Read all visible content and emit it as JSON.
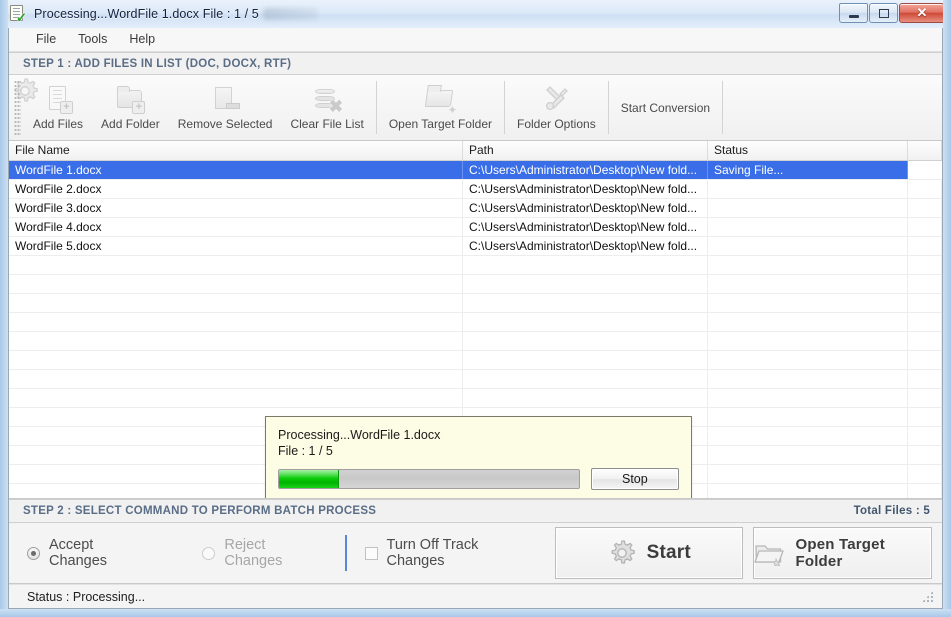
{
  "window": {
    "title": "Processing...WordFile 1.docx File : 1 / 5",
    "icon": "document-check-icon",
    "minimize_label": "–",
    "maximize_label": "□",
    "close_label": "✕"
  },
  "menu": {
    "items": [
      {
        "label": "File"
      },
      {
        "label": "Tools"
      },
      {
        "label": "Help"
      }
    ]
  },
  "step1": {
    "header": "STEP 1 : ADD FILES IN LIST (DOC, DOCX, RTF)"
  },
  "toolbar": {
    "buttons": [
      {
        "label": "Add Files",
        "icon": "add-files-icon"
      },
      {
        "label": "Add Folder",
        "icon": "add-folder-icon"
      },
      {
        "label": "Remove Selected",
        "icon": "remove-selected-icon"
      },
      {
        "label": "Clear File List",
        "icon": "clear-file-list-icon"
      },
      {
        "label": "Open Target Folder",
        "icon": "open-folder-icon"
      },
      {
        "label": "Folder Options",
        "icon": "tools-icon"
      },
      {
        "label": "Start Conversion",
        "icon": "gear-icon"
      }
    ]
  },
  "file_list": {
    "columns": [
      "File Name",
      "Path",
      "Status"
    ],
    "rows": [
      {
        "name": "WordFile 1.docx",
        "path": "C:\\Users\\Administrator\\Desktop\\New fold...",
        "status": "Saving File...",
        "selected": true
      },
      {
        "name": "WordFile 2.docx",
        "path": "C:\\Users\\Administrator\\Desktop\\New fold...",
        "status": "",
        "selected": false
      },
      {
        "name": "WordFile 3.docx",
        "path": "C:\\Users\\Administrator\\Desktop\\New fold...",
        "status": "",
        "selected": false
      },
      {
        "name": "WordFile 4.docx",
        "path": "C:\\Users\\Administrator\\Desktop\\New fold...",
        "status": "",
        "selected": false
      },
      {
        "name": "WordFile 5.docx",
        "path": "C:\\Users\\Administrator\\Desktop\\New fold...",
        "status": "",
        "selected": false
      }
    ]
  },
  "dialog": {
    "line1": "Processing...WordFile 1.docx",
    "line2": "File : 1 / 5",
    "progress_percent": 20,
    "stop_label": "Stop"
  },
  "step2": {
    "header": "STEP 2 : SELECT COMMAND TO PERFORM BATCH PROCESS",
    "total_files": "Total Files : 5",
    "options": [
      {
        "label": "Accept Changes",
        "type": "radio",
        "checked": true,
        "enabled": true
      },
      {
        "label": "Reject Changes",
        "type": "radio",
        "checked": false,
        "enabled": false
      },
      {
        "label": "Turn Off Track Changes",
        "type": "checkbox",
        "checked": false,
        "enabled": true
      }
    ],
    "start_button": "Start",
    "open_target_button": "Open Target Folder"
  },
  "statusbar": {
    "text": "Status :  Processing..."
  },
  "colors": {
    "accent_blue": "#3a6ee8",
    "step_header_text": "#5a6d86",
    "progress_green": "#00b400",
    "dialog_bg": "#fdfce4",
    "close_red": "#cf4a38"
  }
}
